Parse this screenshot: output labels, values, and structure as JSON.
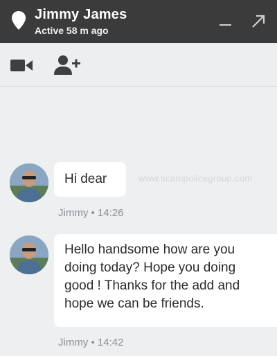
{
  "header": {
    "contact_name": "Jimmy James",
    "status": "Active 58 m ago"
  },
  "toolbar": {
    "video_icon": "video-camera-icon",
    "add_icon": "add-person-icon"
  },
  "watermark": "www.scampolicegroup.com",
  "messages": [
    {
      "text": "Hi dear",
      "sender": "Jimmy",
      "time": "14:26"
    },
    {
      "text": "Hello handsome how are you doing today? Hope you doing good ! Thanks for the add and hope we can be friends.",
      "lines": [
        "Hello handsome how are you",
        "doing today? Hope you doing",
        "good ! Thanks for the add and",
        "hope we can be friends."
      ],
      "sender": "Jimmy",
      "time": "14:42"
    }
  ]
}
